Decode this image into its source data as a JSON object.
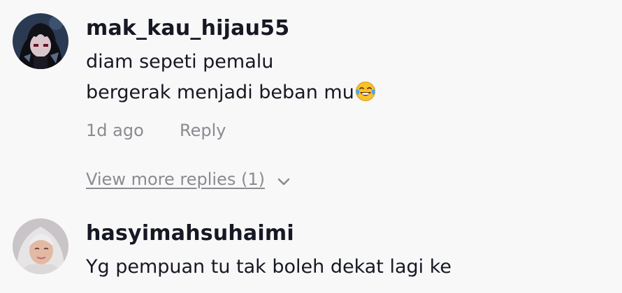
{
  "comments": [
    {
      "avatar_icon": "user-avatar-anime-dark",
      "username": "mak_kau_hijau55",
      "lines": [
        "diam sepeti pemalu",
        "bergerak menjadi beban mu"
      ],
      "emoji_icon": "tears-of-joy-emoji",
      "timestamp": "1d ago",
      "reply_label": "Reply",
      "view_more_label": "View more replies (1)"
    },
    {
      "avatar_icon": "user-avatar-hijab",
      "username": "hasyimahsuhaimi",
      "lines": [
        "Yg pempuan tu tak boleh dekat lagi ke"
      ]
    }
  ],
  "colors": {
    "background": "#f8f8f8",
    "primary_text": "#161823",
    "secondary_text": "#8a8b91"
  }
}
